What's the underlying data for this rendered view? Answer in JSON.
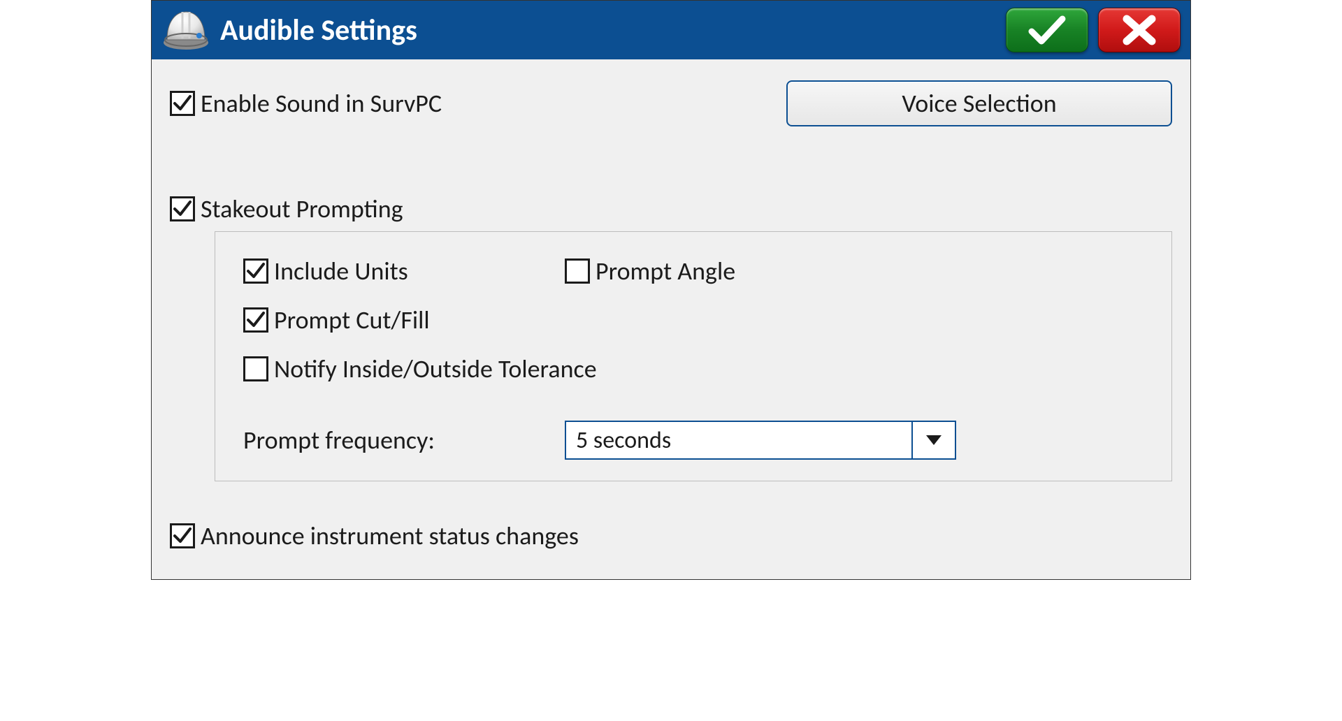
{
  "titlebar": {
    "title": "Audible Settings"
  },
  "enableSound": {
    "label": "Enable Sound in SurvPC",
    "checked": true
  },
  "voiceSelection": {
    "label": "Voice Selection"
  },
  "stakeout": {
    "label": "Stakeout Prompting",
    "checked": true,
    "includeUnits": {
      "label": "Include Units",
      "checked": true
    },
    "promptCutFill": {
      "label": "Prompt Cut/Fill",
      "checked": true
    },
    "notifyTolerance": {
      "label": "Notify Inside/Outside Tolerance",
      "checked": false
    },
    "promptAngle": {
      "label": "Prompt Angle",
      "checked": false
    },
    "promptFrequency": {
      "label": "Prompt frequency:",
      "value": "5 seconds"
    }
  },
  "announce": {
    "label": "Announce instrument status changes",
    "checked": true
  }
}
